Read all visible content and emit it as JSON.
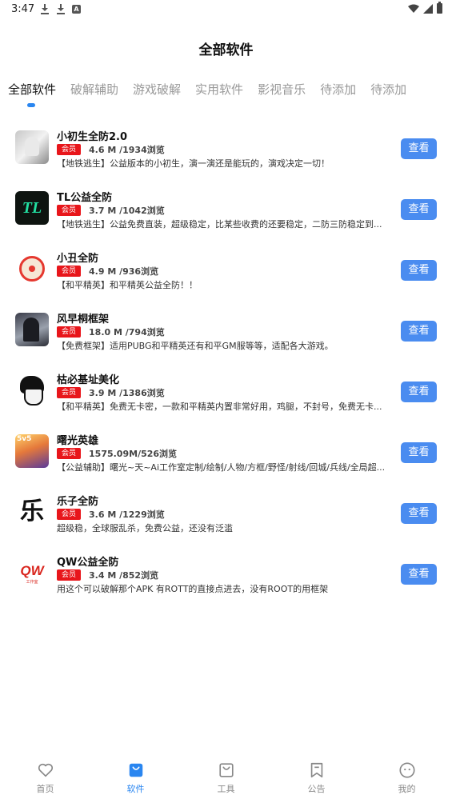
{
  "status_bar": {
    "time": "3:47",
    "left_icons": [
      "download-icon",
      "download-icon",
      "a-icon"
    ],
    "right_icons": [
      "wifi-icon",
      "signal-icon",
      "battery-icon"
    ]
  },
  "page": {
    "title": "全部软件"
  },
  "tabs": [
    {
      "label": "全部软件",
      "active": true
    },
    {
      "label": "破解辅助",
      "active": false
    },
    {
      "label": "游戏破解",
      "active": false
    },
    {
      "label": "实用软件",
      "active": false
    },
    {
      "label": "影视音乐",
      "active": false
    },
    {
      "label": "待添加",
      "active": false
    },
    {
      "label": "待添加",
      "active": false
    }
  ],
  "apps": [
    {
      "name": "小初生全防2.0",
      "badge": "会员",
      "stats": "4.6 M /1934浏览",
      "desc": "【地铁逃生】公益版本的小初生，演一演还是能玩的，演戏决定一切！",
      "button": "查看",
      "icon": "anime-girl-icon"
    },
    {
      "name": "TL公益全防",
      "badge": "会员",
      "stats": "3.7 M /1042浏览",
      "desc": "【地铁逃生】公益免费直装，超级稳定，比某些收费的还要稳定，二防三防稳定到...",
      "button": "查看",
      "icon": "tl-logo-icon",
      "icon_text": "TL"
    },
    {
      "name": "小丑全防",
      "badge": "会员",
      "stats": "4.9 M /936浏览",
      "desc": "【和平精英】和平精英公益全防！！",
      "button": "查看",
      "icon": "clown-icon"
    },
    {
      "name": "风早桐框架",
      "badge": "会员",
      "stats": "18.0 M /794浏览",
      "desc": "【免费框架】适用PUBG和平精英还有和平GM服等等，适配各大游戏。",
      "button": "查看",
      "icon": "anime-swordsman-icon"
    },
    {
      "name": "枯必基址美化",
      "badge": "会员",
      "stats": "3.9 M /1386浏览",
      "desc": "【和平精英】免费无卡密，一款和平精英内置非常好用，鸡腿，不封号，免费无卡...",
      "button": "查看",
      "icon": "anime-boy-icon"
    },
    {
      "name": "曙光英雄",
      "badge": "会员",
      "stats": "1575.09M/526浏览",
      "desc": "【公益辅助】曙光~天~Ai工作室定制/绘制/人物/方框/野怪/射线/回城/兵线/全局超...",
      "button": "查看",
      "icon": "game-hero-icon",
      "icon_text": "5v5"
    },
    {
      "name": "乐子全防",
      "badge": "会员",
      "stats": "3.6 M /1229浏览",
      "desc": "超级稳，全球服乱杀，免费公益，还没有泛滥",
      "button": "查看",
      "icon": "calligraphy-le-icon",
      "icon_text": "乐"
    },
    {
      "name": "QW公益全防",
      "badge": "会员",
      "stats": "3.4 M /852浏览",
      "desc": "用这个可以破解那个APK 有ROTT的直接点进去，没有ROOT的用框架",
      "button": "查看",
      "icon": "qw-logo-icon",
      "icon_text": "QW",
      "icon_subtext": "工作室"
    }
  ],
  "bottom_nav": [
    {
      "label": "首页",
      "icon": "heart-icon",
      "active": false
    },
    {
      "label": "软件",
      "icon": "shopping-bag-icon",
      "active": true
    },
    {
      "label": "工具",
      "icon": "bag-outline-icon",
      "active": false
    },
    {
      "label": "公告",
      "icon": "bookmark-icon",
      "active": false
    },
    {
      "label": "我的",
      "icon": "smiley-icon",
      "active": false
    }
  ],
  "colors": {
    "accent": "#2a86f0",
    "button": "#4a8cf0",
    "badge": "#e8161b",
    "tab_inactive": "#999999"
  }
}
